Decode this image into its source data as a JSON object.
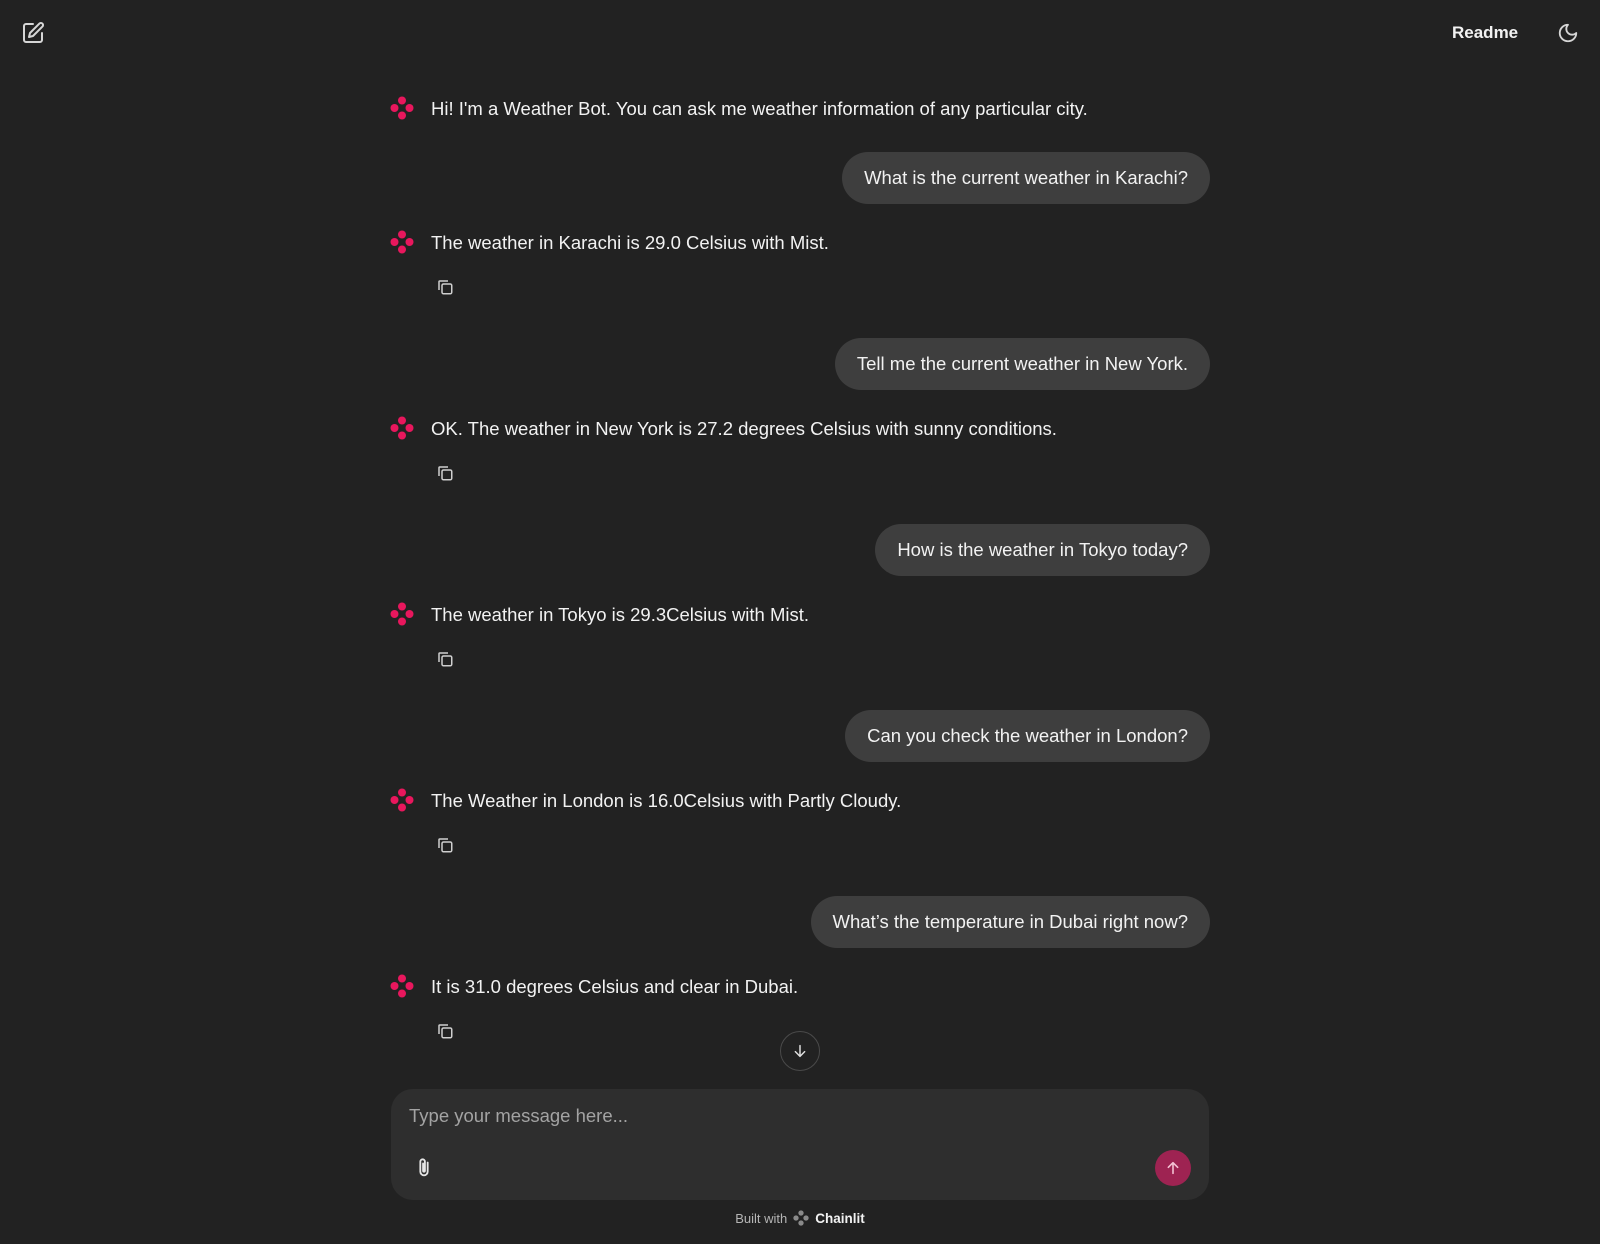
{
  "header": {
    "new_chat_icon": "edit-square-icon",
    "readme_label": "Readme",
    "theme_icon": "moon-icon"
  },
  "messages": [
    {
      "role": "assistant",
      "text": "Hi! I'm a Weather Bot. You can ask me weather information of any particular city."
    },
    {
      "role": "user",
      "text": "What is the current weather in Karachi?"
    },
    {
      "role": "assistant",
      "text": "The weather in Karachi is 29.0 Celsius with Mist."
    },
    {
      "role": "user",
      "text": "Tell me the current weather in New York."
    },
    {
      "role": "assistant",
      "text": "OK. The weather in New York is 27.2 degrees Celsius with sunny conditions."
    },
    {
      "role": "user",
      "text": "How is the weather in Tokyo today?"
    },
    {
      "role": "assistant",
      "text": "The weather in Tokyo is 29.3Celsius with Mist."
    },
    {
      "role": "user",
      "text": "Can you check the weather in London?"
    },
    {
      "role": "assistant",
      "text": "The Weather in London is 16.0Celsius with Partly Cloudy."
    },
    {
      "role": "user",
      "text": "What’s the temperature in Dubai right now?"
    },
    {
      "role": "assistant",
      "text": "It is 31.0 degrees Celsius and clear in Dubai."
    }
  ],
  "composer": {
    "placeholder": "Type your message here...",
    "value": ""
  },
  "footer": {
    "built_with": "Built with",
    "brand": "Chainlit"
  },
  "colors": {
    "background": "#222222",
    "bubble": "#3e3e3e",
    "accent": "#e8175d",
    "send_button": "#9e2352"
  }
}
